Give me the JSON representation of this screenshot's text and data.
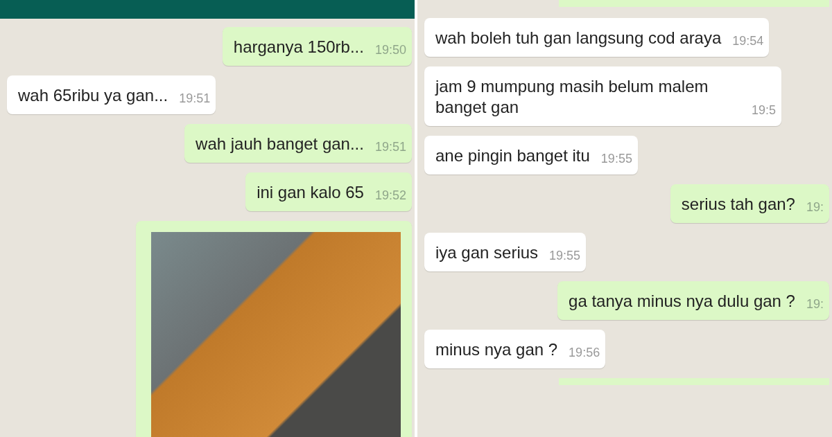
{
  "panels": [
    {
      "header": true,
      "messages": [
        {
          "kind": "outgoing",
          "text": "harganya 150rb...",
          "time": "19:50"
        },
        {
          "kind": "incoming",
          "text": "wah 65ribu ya gan...",
          "time": "19:51"
        },
        {
          "kind": "outgoing",
          "text": "wah jauh banget gan...",
          "time": "19:51"
        },
        {
          "kind": "outgoing",
          "text": "ini gan kalo 65",
          "time": "19:52"
        },
        {
          "kind": "image"
        }
      ]
    },
    {
      "header": false,
      "messages": [
        {
          "kind": "cut"
        },
        {
          "kind": "incoming",
          "text": "wah boleh tuh gan langsung cod araya",
          "time": "19:54"
        },
        {
          "kind": "incoming",
          "text": "jam 9 mumpung masih belum malem banget gan",
          "time": "19:5"
        },
        {
          "kind": "incoming",
          "text": "ane pingin banget itu",
          "time": "19:55"
        },
        {
          "kind": "outgoing",
          "text": "serius tah gan?",
          "time": "19:"
        },
        {
          "kind": "incoming",
          "text": "iya gan serius",
          "time": "19:55"
        },
        {
          "kind": "outgoing",
          "text": "ga tanya minus nya dulu gan ?",
          "time": "19:"
        },
        {
          "kind": "incoming",
          "text": "minus nya gan ?",
          "time": "19:56"
        },
        {
          "kind": "cut"
        }
      ]
    }
  ]
}
